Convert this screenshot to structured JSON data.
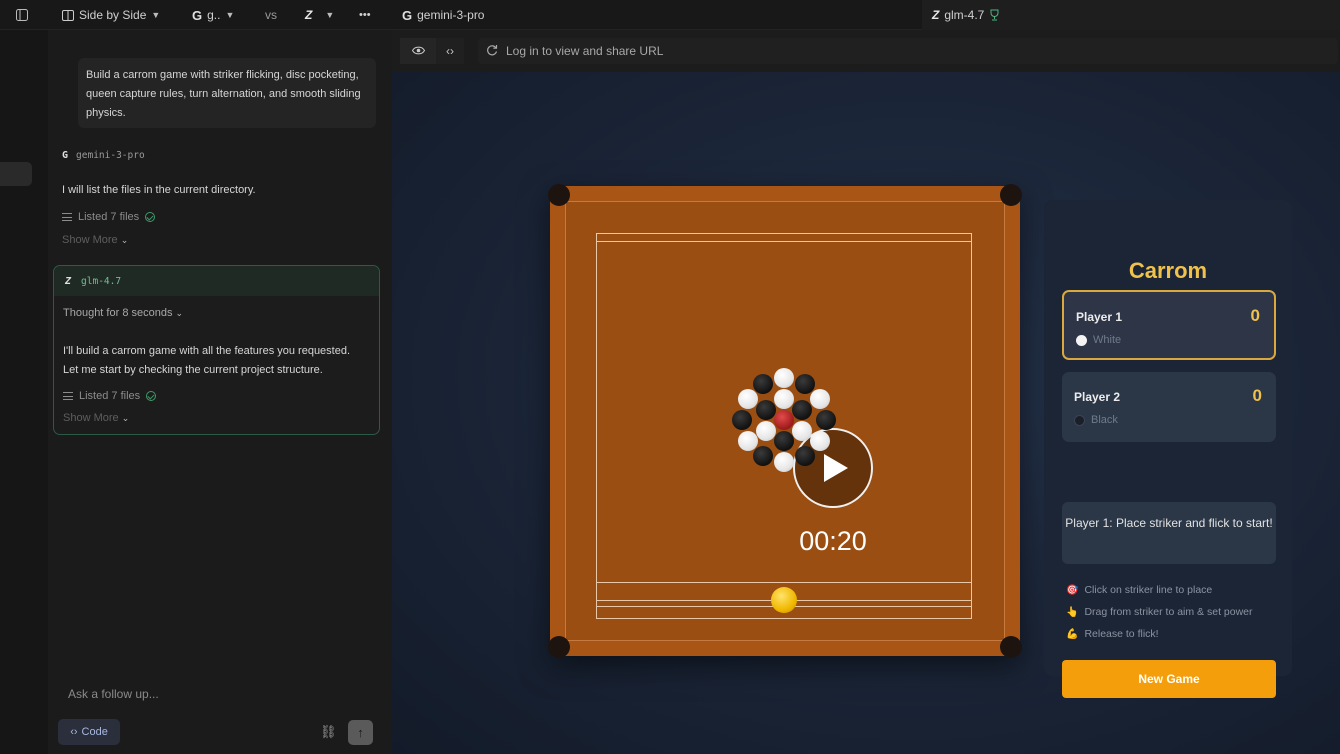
{
  "topbar": {
    "layout_mode": "Side by Side",
    "model_a_short": "g..",
    "versus": "vs",
    "more": "•••",
    "left_tab": "gemini-3-pro",
    "right_tab": "glm-4.7"
  },
  "chat": {
    "prompt": "Build a carrom game with striker flicking, disc pocketing, queen capture rules, turn alternation, and smooth sliding physics.",
    "gemini": {
      "model": "gemini-3-pro",
      "message": "I will list the files in the current directory.",
      "listed": "Listed 7 files",
      "show_more": "Show More"
    },
    "glm": {
      "model": "glm-4.7",
      "thought": "Thought for 8 seconds",
      "message_line1": "I'll build a carrom game with all the features you requested.",
      "message_line2": "Let me start by checking the current project structure.",
      "listed": "Listed 7 files",
      "show_more": "Show More"
    },
    "followup_placeholder": "Ask a follow up...",
    "code_button": "Code"
  },
  "preview": {
    "url_text": "Log in to view and share URL",
    "video_time": "00:20",
    "game": {
      "title": "Carrom",
      "player1": {
        "name": "Player 1",
        "score": "0",
        "color": "White"
      },
      "player2": {
        "name": "Player 2",
        "score": "0",
        "color": "Black"
      },
      "status": "Player 1: Place striker and flick to start!",
      "instructions": [
        {
          "icon": "🎯",
          "text": "Click on striker line to place"
        },
        {
          "icon": "👆",
          "text": "Drag from striker to aim & set power"
        },
        {
          "icon": "💪",
          "text": "Release to flick!"
        }
      ],
      "new_game": "New Game"
    }
  },
  "colors": {
    "accent_gold": "#f0c14b",
    "new_game_button": "#f59e0b",
    "board": "#a85515",
    "glm_border": "#2d5a46"
  }
}
